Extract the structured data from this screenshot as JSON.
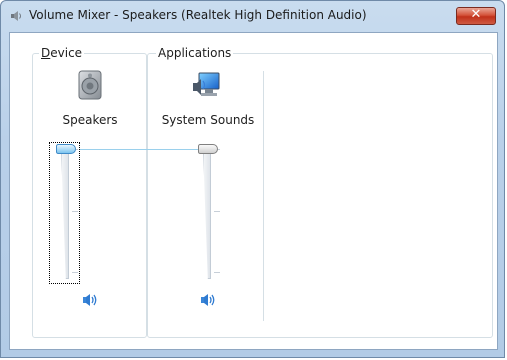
{
  "window": {
    "title": "Volume Mixer - Speakers (Realtek High Definition Audio)",
    "close_glyph": "✕"
  },
  "groups": {
    "device_label_accel": "D",
    "device_label_rest": "evice",
    "applications_label": "Applications"
  },
  "channels": [
    {
      "name": "Speakers",
      "icon": "speaker-device-icon",
      "volume_fraction": 1.0,
      "mute_icon": "speaker-volume-icon",
      "focused": true
    },
    {
      "name": "System Sounds",
      "icon": "system-sounds-icon",
      "volume_fraction": 1.0,
      "mute_icon": "speaker-volume-icon",
      "focused": false
    }
  ],
  "colors": {
    "titlebar": "#b9d0e9",
    "close_button": "#c0311a",
    "thumb_active": "#7cc4ef",
    "link_line": "#9ad0ec"
  }
}
